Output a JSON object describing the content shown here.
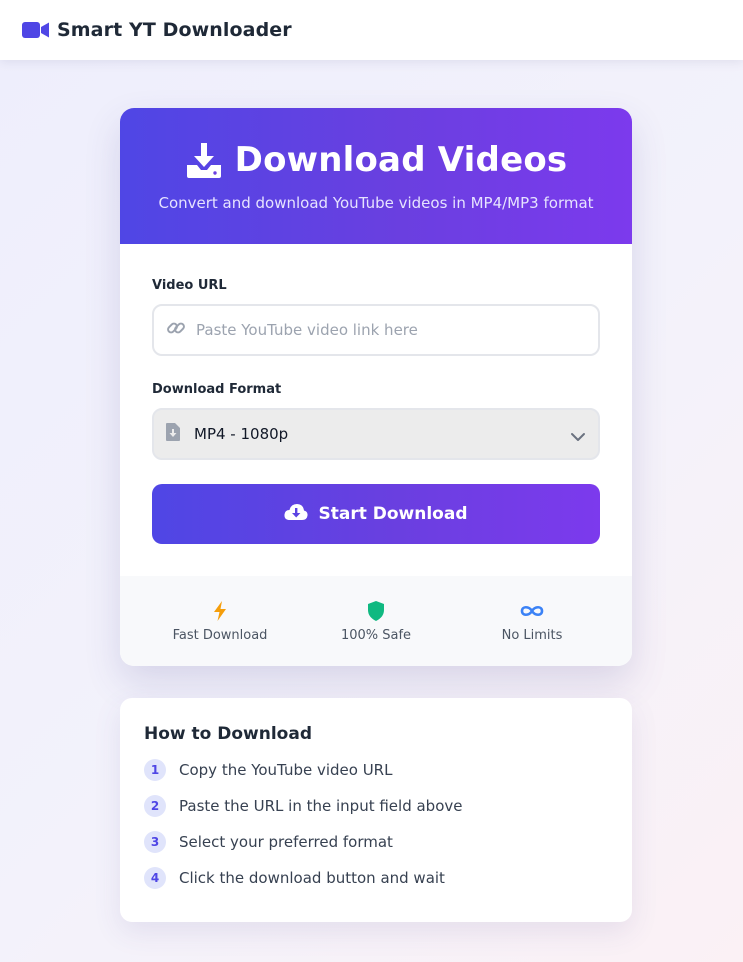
{
  "app": {
    "brand": "Smart YT Downloader",
    "brand_icon": "video-camera-icon",
    "accent_start": "#4f46e5",
    "accent_end": "#7c3aed"
  },
  "hero": {
    "title": "Download Videos",
    "subtitle": "Convert and download YouTube videos in MP4/MP3 format",
    "icon": "download-tray-icon"
  },
  "form": {
    "url_label": "Video URL",
    "url_placeholder": "Paste YouTube video link here",
    "url_value": "",
    "url_icon": "link-icon",
    "format_label": "Download Format",
    "format_selected": "MP4 - 1080p",
    "format_icon": "file-download-icon",
    "submit_label": "Start Download",
    "submit_icon": "cloud-download-icon"
  },
  "features": [
    {
      "label": "Fast Download",
      "icon": "bolt-icon",
      "color": "#f59e0b"
    },
    {
      "label": "100% Safe",
      "icon": "shield-icon",
      "color": "#10b981"
    },
    {
      "label": "No Limits",
      "icon": "infinity-icon",
      "color": "#3b82f6"
    }
  ],
  "howto": {
    "title": "How to Download",
    "steps": [
      {
        "num": "1",
        "text": "Copy the YouTube video URL"
      },
      {
        "num": "2",
        "text": "Paste the URL in the input field above"
      },
      {
        "num": "3",
        "text": "Select your preferred format"
      },
      {
        "num": "4",
        "text": "Click the download button and wait"
      }
    ]
  }
}
